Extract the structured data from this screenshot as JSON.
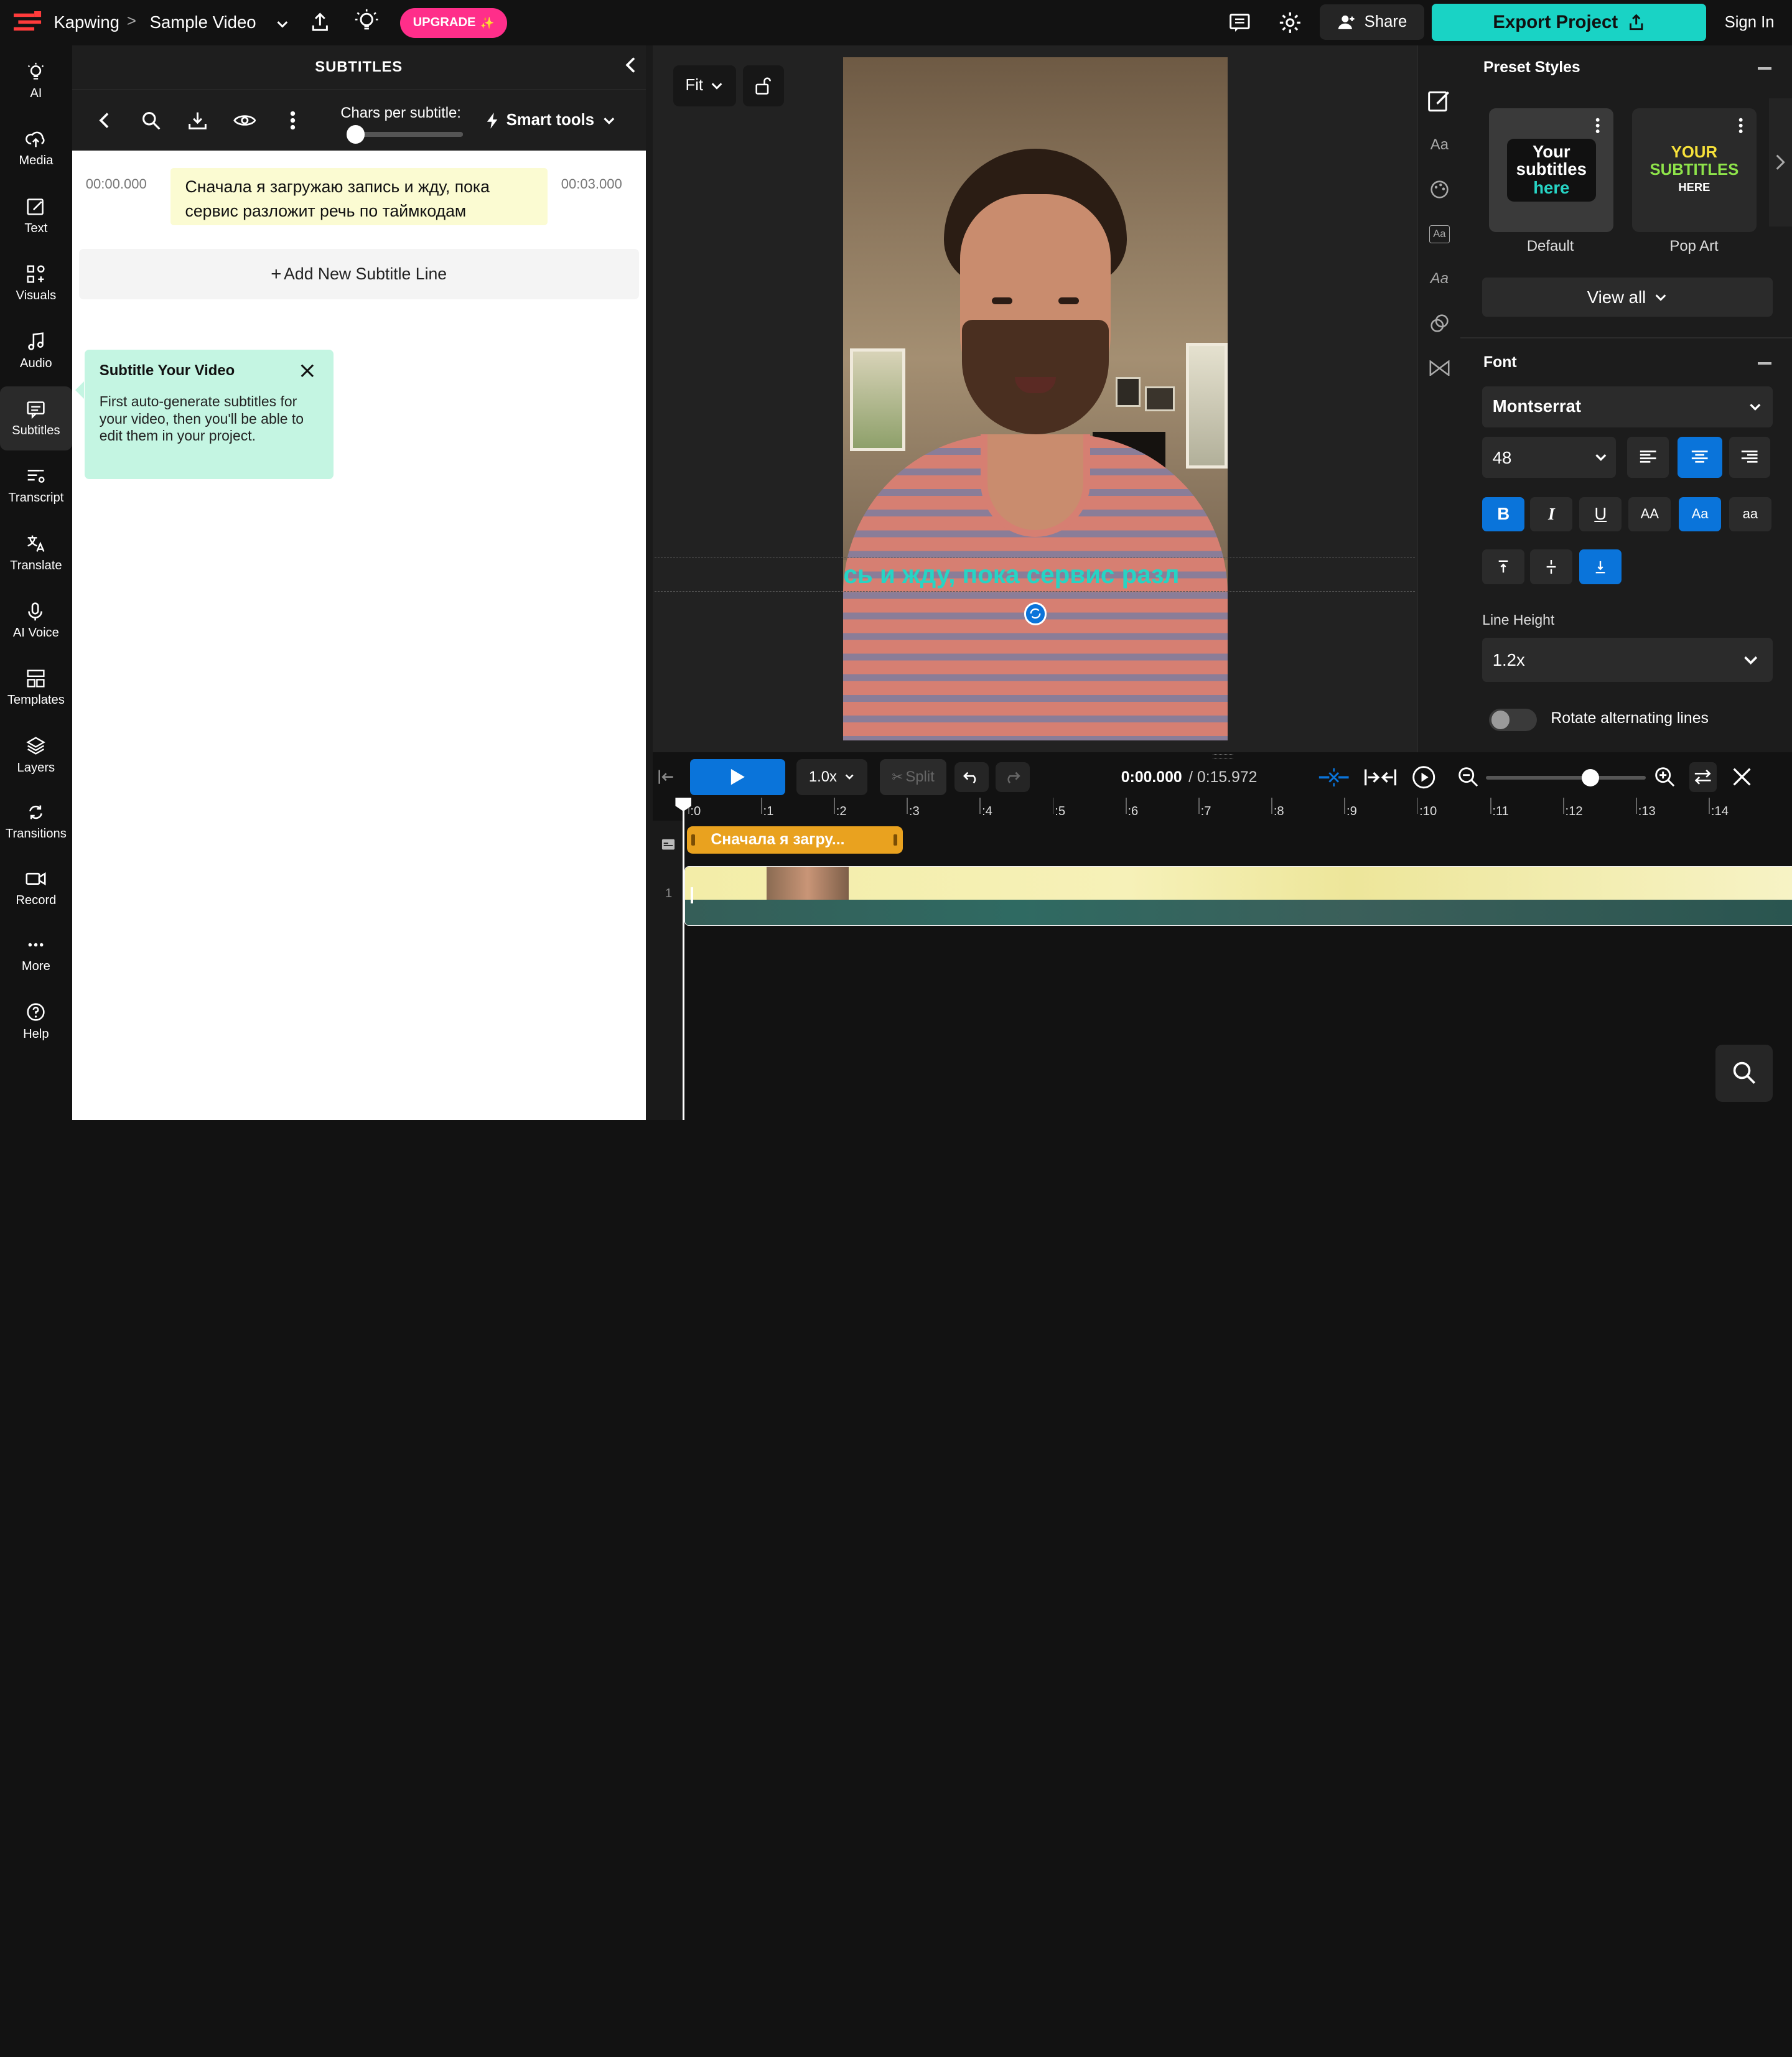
{
  "topbar": {
    "brand": "Kapwing",
    "separator": ">",
    "project_name": "Sample Video",
    "upgrade_label": "UPGRADE",
    "share_label": "Share",
    "export_label": "Export Project",
    "signin_label": "Sign In"
  },
  "leftnav": {
    "items": [
      {
        "label": "AI",
        "icon": "bulb-icon"
      },
      {
        "label": "Media",
        "icon": "upload-cloud-icon"
      },
      {
        "label": "Text",
        "icon": "text-edit-icon"
      },
      {
        "label": "Visuals",
        "icon": "visuals-icon"
      },
      {
        "label": "Audio",
        "icon": "music-icon"
      },
      {
        "label": "Subtitles",
        "icon": "subtitles-icon"
      },
      {
        "label": "Transcript",
        "icon": "transcript-icon"
      },
      {
        "label": "Translate",
        "icon": "translate-icon"
      },
      {
        "label": "AI Voice",
        "icon": "ai-voice-icon"
      },
      {
        "label": "Templates",
        "icon": "templates-icon"
      },
      {
        "label": "Layers",
        "icon": "layers-icon"
      },
      {
        "label": "Transitions",
        "icon": "transitions-icon"
      },
      {
        "label": "Record",
        "icon": "record-icon"
      },
      {
        "label": "More",
        "icon": "more-icon"
      },
      {
        "label": "Help",
        "icon": "help-icon"
      }
    ]
  },
  "subtitles": {
    "title": "SUBTITLES",
    "chars_label": "Chars per subtitle:",
    "chars_slider_value": 0.08,
    "smart_tools_label": "Smart tools",
    "line": {
      "start": "00:00.000",
      "end": "00:03.000",
      "text": "Сначала я загружаю запись и жду, пока сервис разложит речь по таймкодам"
    },
    "add_line_label": "Add New Subtitle Line",
    "tooltip": {
      "title": "Subtitle Your Video",
      "body": "First auto-generate subtitles for your video, then you'll be able to edit them in your project."
    }
  },
  "preview": {
    "fit_label": "Fit",
    "caption_text": "сь и жду, пока сервис разл"
  },
  "styles": {
    "preset_title": "Preset Styles",
    "presets": [
      {
        "name": "Default",
        "thumb_lines": [
          "Your",
          "subtitles",
          "here"
        ]
      },
      {
        "name": "Pop Art",
        "thumb_lines": [
          "YOUR",
          "SUBTITLES",
          "HERE"
        ]
      }
    ],
    "view_all_label": "View all",
    "font_title": "Font",
    "font_name": "Montserrat",
    "font_size": "48",
    "case_labels": [
      "AA",
      "Aa",
      "aa"
    ],
    "line_height_title": "Line Height",
    "line_height_value": "1.2x",
    "rotate_label": "Rotate alternating lines",
    "rotate_on": false
  },
  "timeline": {
    "speed": "1.0x",
    "split_label": "Split",
    "current_time": "0:00.000",
    "total_time": "/ 0:15.972",
    "zoom_value": 0.65,
    "ticks": [
      ":0",
      ":1",
      ":2",
      ":3",
      ":4",
      ":5",
      ":6",
      ":7",
      ":8",
      ":9",
      ":10",
      ":11",
      ":12",
      ":13",
      ":14"
    ],
    "subtitle_clip_label": "Сначала я загру...",
    "track_number": "1"
  },
  "colors": {
    "accent_cyan": "#19d3c5",
    "accent_blue": "#0a74da",
    "upgrade_pink": "#ff2e8a",
    "clip_orange": "#e9a21f",
    "caption_teal": "#27d4c4"
  }
}
